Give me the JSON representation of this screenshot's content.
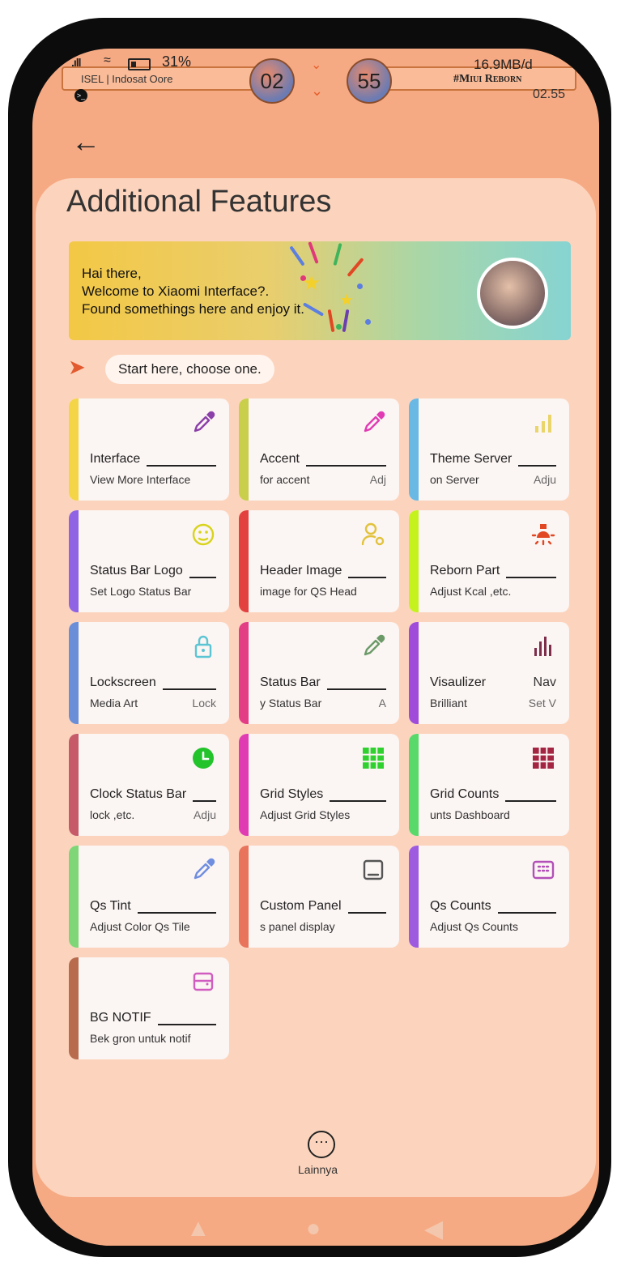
{
  "status": {
    "battery": "31%",
    "carrier": "ISEL | Indosat Oore",
    "hour_bubble": "02",
    "minute_bubble": "55",
    "net_speed": "16.9MB/d",
    "brand": "#Miui Reborn",
    "time": "02.55"
  },
  "page": {
    "title": "Additional Features"
  },
  "banner": {
    "line1": "Hai there,",
    "line2": "Welcome to Xiaomi Interface?.",
    "line3": "Found somethings here and enjoy it."
  },
  "prompt": "Start here, choose one.",
  "tiles": [
    {
      "title": "Interface",
      "sub": "View More Interface",
      "sub2": "",
      "accent": "#f5d548",
      "icon": "color-picker-icon",
      "iconColor": "#8b3fa8"
    },
    {
      "title": "Accent",
      "sub": "for accent",
      "sub2": "Adj",
      "accent": "#c9cf4b",
      "icon": "color-picker-icon",
      "iconColor": "#e13bb3"
    },
    {
      "title": "Theme Server",
      "sub": "on Server",
      "sub2": "Adju",
      "accent": "#6ab9e4",
      "icon": "signal-bars-icon",
      "iconColor": "#e9d56a"
    },
    {
      "title": "Status Bar Logo",
      "sub": "Set Logo Status Bar",
      "sub2": "",
      "accent": "#8f63e3",
      "icon": "emoji-icon",
      "iconColor": "#d8d31b"
    },
    {
      "title": "Header Image",
      "sub": "image for QS Head",
      "sub2": "",
      "accent": "#e34040",
      "icon": "user-settings-icon",
      "iconColor": "#e2c23c"
    },
    {
      "title": "Reborn Part",
      "sub": "Adjust Kcal ,etc.",
      "sub2": "",
      "accent": "#c5f21d",
      "icon": "lamp-icon",
      "iconColor": "#e14723"
    },
    {
      "title": "Lockscreen",
      "sub": "Media Art",
      "sub2": "Lock",
      "accent": "#6b8ed8",
      "icon": "lock-icon",
      "iconColor": "#5cc5d4"
    },
    {
      "title": "Status Bar",
      "sub": "y Status Bar",
      "sub2": "A",
      "accent": "#e33d85",
      "icon": "color-picker-icon",
      "iconColor": "#6b9a68"
    },
    {
      "title": "Visaulizer",
      "sub": "Brilliant",
      "sub2": "Nav",
      "sub3": "Set V",
      "accent": "#a04bd9",
      "icon": "visualizer-icon",
      "iconColor": "#7e2d4a"
    },
    {
      "title": "Clock Status Bar",
      "sub": "lock ,etc.",
      "sub2": "Adju",
      "accent": "#c65a68",
      "icon": "clock-icon",
      "iconColor": "#22c32b"
    },
    {
      "title": "Grid Styles",
      "sub": "Adjust Grid Styles",
      "sub2": "",
      "accent": "#e13bb3",
      "icon": "grid-icon",
      "iconColor": "#2ed12e"
    },
    {
      "title": "Grid Counts",
      "sub": "unts Dashboard",
      "sub2": "",
      "accent": "#58d96a",
      "icon": "grid-icon",
      "iconColor": "#a32542"
    },
    {
      "title": "Qs Tint",
      "sub": "Adjust Color Qs Tile",
      "sub2": "",
      "accent": "#7fd676",
      "icon": "color-picker-icon",
      "iconColor": "#6f8ee0"
    },
    {
      "title": "Custom Panel",
      "sub": "s panel display",
      "sub2": "",
      "accent": "#e8745b",
      "icon": "panel-icon",
      "iconColor": "#555555"
    },
    {
      "title": "Qs Counts",
      "sub": "Adjust Qs Counts",
      "sub2": "",
      "accent": "#9f5be0",
      "icon": "keypad-icon",
      "iconColor": "#b34fb8"
    },
    {
      "title": "BG NOTIF",
      "sub": "Bek gron untuk notif",
      "sub2": "",
      "accent": "#b86b4d",
      "icon": "notification-box-icon",
      "iconColor": "#d15cbf"
    }
  ],
  "more": {
    "label": "Lainnya"
  },
  "colors": {
    "background": "#f6aa84",
    "card": "#fcd4bd",
    "tile": "#fbf5f3"
  }
}
